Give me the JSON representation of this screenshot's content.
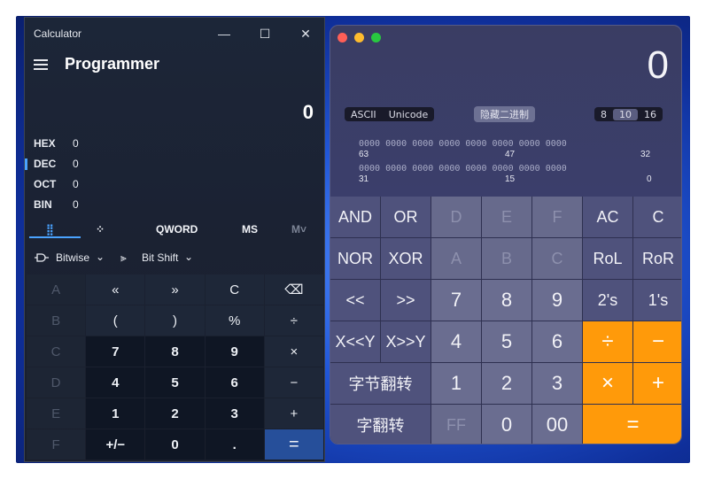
{
  "win": {
    "app_title": "Calculator",
    "mode": "Programmer",
    "display": "0",
    "caption": {
      "minimize": "—",
      "maximize": "☐",
      "close": "✕"
    },
    "bases": [
      {
        "name": "HEX",
        "value": "0"
      },
      {
        "name": "DEC",
        "value": "0"
      },
      {
        "name": "OCT",
        "value": "0"
      },
      {
        "name": "BIN",
        "value": "0"
      }
    ],
    "tabs": {
      "keypad_icon": "⣿",
      "bitflip_icon": "⁘",
      "word": "QWORD",
      "ms": "MS",
      "mv": "M˅"
    },
    "bitwise": "Bitwise",
    "bitshift": "Bit Shift",
    "keys": [
      "A",
      "«",
      "»",
      "C",
      "⌫",
      "B",
      "(",
      ")",
      "%",
      "÷",
      "C",
      "7",
      "8",
      "9",
      "×",
      "D",
      "4",
      "5",
      "6",
      "−",
      "E",
      "1",
      "2",
      "3",
      "+",
      "F",
      "+/−",
      "0",
      ".",
      "="
    ]
  },
  "mac": {
    "display": "0",
    "ascii": "ASCII",
    "unicode": "Unicode",
    "hide_binary": "隐藏二进制",
    "bases": [
      "8",
      "10",
      "16"
    ],
    "bit_rows": [
      {
        "bits": "0000 0000 0000 0000 0000 0000 0000 0000",
        "left": "63",
        "mid": "47",
        "right": "32"
      },
      {
        "bits": "0000 0000 0000 0000 0000 0000 0000 0000",
        "left": "31",
        "mid": "15",
        "right": "0"
      }
    ],
    "keys": [
      "AND",
      "OR",
      "D",
      "E",
      "F",
      "AC",
      "C",
      "NOR",
      "XOR",
      "A",
      "B",
      "C",
      "RoL",
      "RoR",
      "<<",
      ">>",
      "7",
      "8",
      "9",
      "2's",
      "1's",
      "X<<Y",
      "X>>Y",
      "4",
      "5",
      "6",
      "÷",
      "−",
      "字节翻转",
      "1",
      "2",
      "3",
      "×",
      "+",
      "字翻转",
      "FF",
      "0",
      "00",
      "="
    ]
  }
}
